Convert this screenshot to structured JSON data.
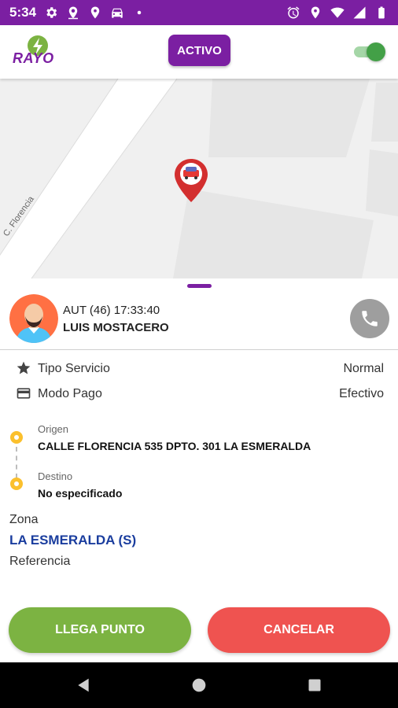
{
  "status_bar": {
    "time": "5:34",
    "left_icons": [
      "gear-icon",
      "location-mark-icon",
      "location-pin-icon",
      "car-icon",
      "dot-icon"
    ],
    "right_icons": [
      "alarm-icon",
      "location-pin-icon",
      "wifi-icon",
      "signal-icon",
      "battery-icon"
    ],
    "background": "#7b1fa2"
  },
  "app_bar": {
    "logo_text": "RAYO",
    "status_button": "ACTIVO",
    "toggle_on": true,
    "accent": "#7b1fa2",
    "toggle_color": "#43a047"
  },
  "map": {
    "street_label": "C. Florencia",
    "marker_icon": "car-marker-icon"
  },
  "driver": {
    "code": "AUT (46) 17:33:40",
    "name": "LUIS MOSTACERO",
    "avatar_icon": "driver-avatar-icon",
    "call_icon": "phone-icon"
  },
  "service": {
    "tipo_label": "Tipo Servicio",
    "tipo_value": "Normal",
    "pago_label": "Modo Pago",
    "pago_value": "Efectivo"
  },
  "route": {
    "origin_caption": "Origen",
    "origin_address": "CALLE FLORENCIA 535 DPTO. 301 LA ESMERALDA",
    "destination_caption": "Destino",
    "destination_address": "No especificado"
  },
  "zona": {
    "label": "Zona",
    "value": "LA ESMERALDA (S)",
    "reference_label": "Referencia"
  },
  "actions": {
    "arrive_label": "LLEGA PUNTO",
    "cancel_label": "CANCELAR",
    "arrive_color": "#7cb342",
    "cancel_color": "#ef5350"
  },
  "nav_bar": {
    "icons": [
      "back-icon",
      "home-icon",
      "recents-icon"
    ]
  }
}
